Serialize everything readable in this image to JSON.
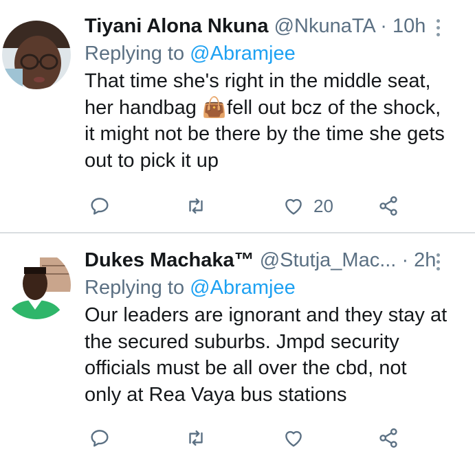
{
  "tweets": [
    {
      "name": "Tiyani Alona Nkuna",
      "handle": "@NkunaTA",
      "separator": "·",
      "time": "10h",
      "replying_prefix": "Replying to",
      "replying_to": "@Abramjee",
      "text_lines": [
        "That time she's right in the middle seat,",
        "her handbag 👜fell out bcz of the shock,",
        "it might not be there by the time she gets",
        "out to pick it up"
      ],
      "like_count": "20",
      "avatar_desc": "avatar"
    },
    {
      "name": "Dukes Machaka™",
      "handle": "@Stutja_Mac...",
      "separator": "·",
      "time": "2h",
      "replying_prefix": "Replying to",
      "replying_to": "@Abramjee",
      "text_lines": [
        "Our leaders are ignorant and they stay at",
        "the secured suburbs. Jmpd security",
        "officials must be all over the cbd, not",
        "only at Rea Vaya bus stations"
      ],
      "like_count": "",
      "avatar_desc": "avatar"
    }
  ],
  "icons": {
    "reply": "reply-icon",
    "retweet": "retweet-icon",
    "like": "heart-icon",
    "share": "share-icon",
    "more": "more-options-icon"
  },
  "colors": {
    "text": "#14171a",
    "muted": "#5b7083",
    "link": "#1da1f2",
    "divider": "#d9dde0"
  }
}
